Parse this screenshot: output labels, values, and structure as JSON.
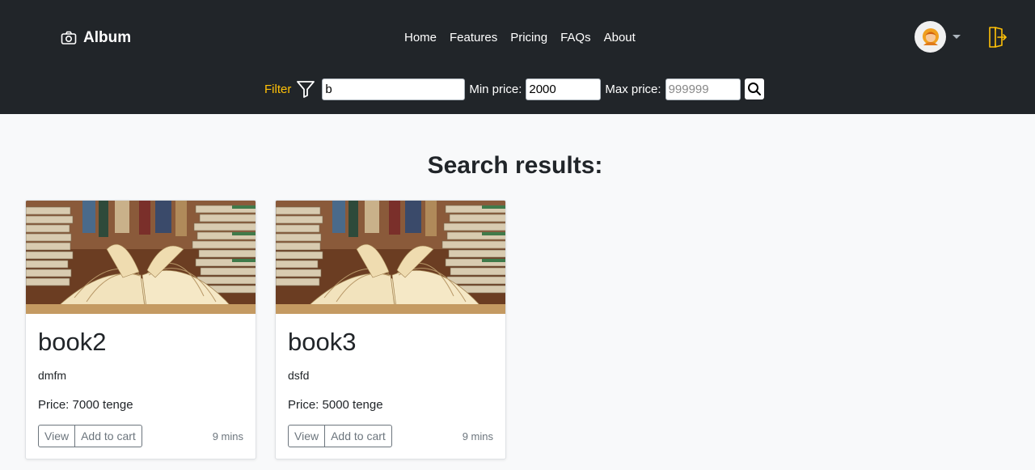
{
  "brand": {
    "name": "Album",
    "icon": "camera-icon"
  },
  "nav": {
    "items": [
      "Home",
      "Features",
      "Pricing",
      "FAQs",
      "About"
    ]
  },
  "user": {
    "avatar_icon": "avatar-icon",
    "dropdown_icon": "caret-down-icon"
  },
  "logout": {
    "icon": "logout-icon"
  },
  "filter": {
    "label": "Filter",
    "icon": "filter-icon",
    "query_value": "b",
    "min_label": "Min price:",
    "min_value": "2000",
    "max_label": "Max price:",
    "max_placeholder": "999999",
    "search_icon": "search-icon"
  },
  "main": {
    "heading": "Search results:",
    "cards": [
      {
        "title": "book2",
        "description": "dmfm",
        "price": "Price: 7000 tenge",
        "view_label": "View",
        "cart_label": "Add to cart",
        "time": "9 mins"
      },
      {
        "title": "book3",
        "description": "dsfd",
        "price": "Price: 5000 tenge",
        "view_label": "View",
        "cart_label": "Add to cart",
        "time": "9 mins"
      }
    ]
  },
  "colors": {
    "navbar_bg": "#212529",
    "accent": "#ffc107",
    "page_bg": "#f8f9fa"
  }
}
